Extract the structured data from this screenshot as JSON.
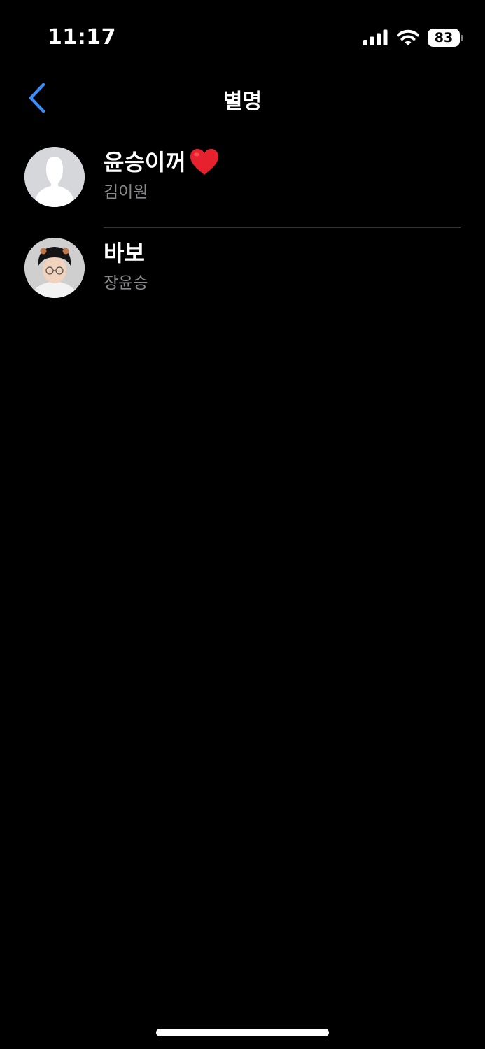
{
  "status_bar": {
    "time": "11:17",
    "battery_percent": "83",
    "battery_level": 0.83
  },
  "nav": {
    "title": "별명",
    "back_icon": "chevron-left-icon",
    "accent_color": "#3a8ef6"
  },
  "contacts": [
    {
      "nickname": "윤승이꺼",
      "emoji": "heart-icon",
      "real_name": "김이원",
      "avatar": "default-person-avatar"
    },
    {
      "nickname": "바보",
      "real_name": "장윤승",
      "avatar": "photo-avatar"
    }
  ],
  "colors": {
    "background": "#000000",
    "secondary_text": "#8a8a8e",
    "heart": "#e8212f"
  }
}
